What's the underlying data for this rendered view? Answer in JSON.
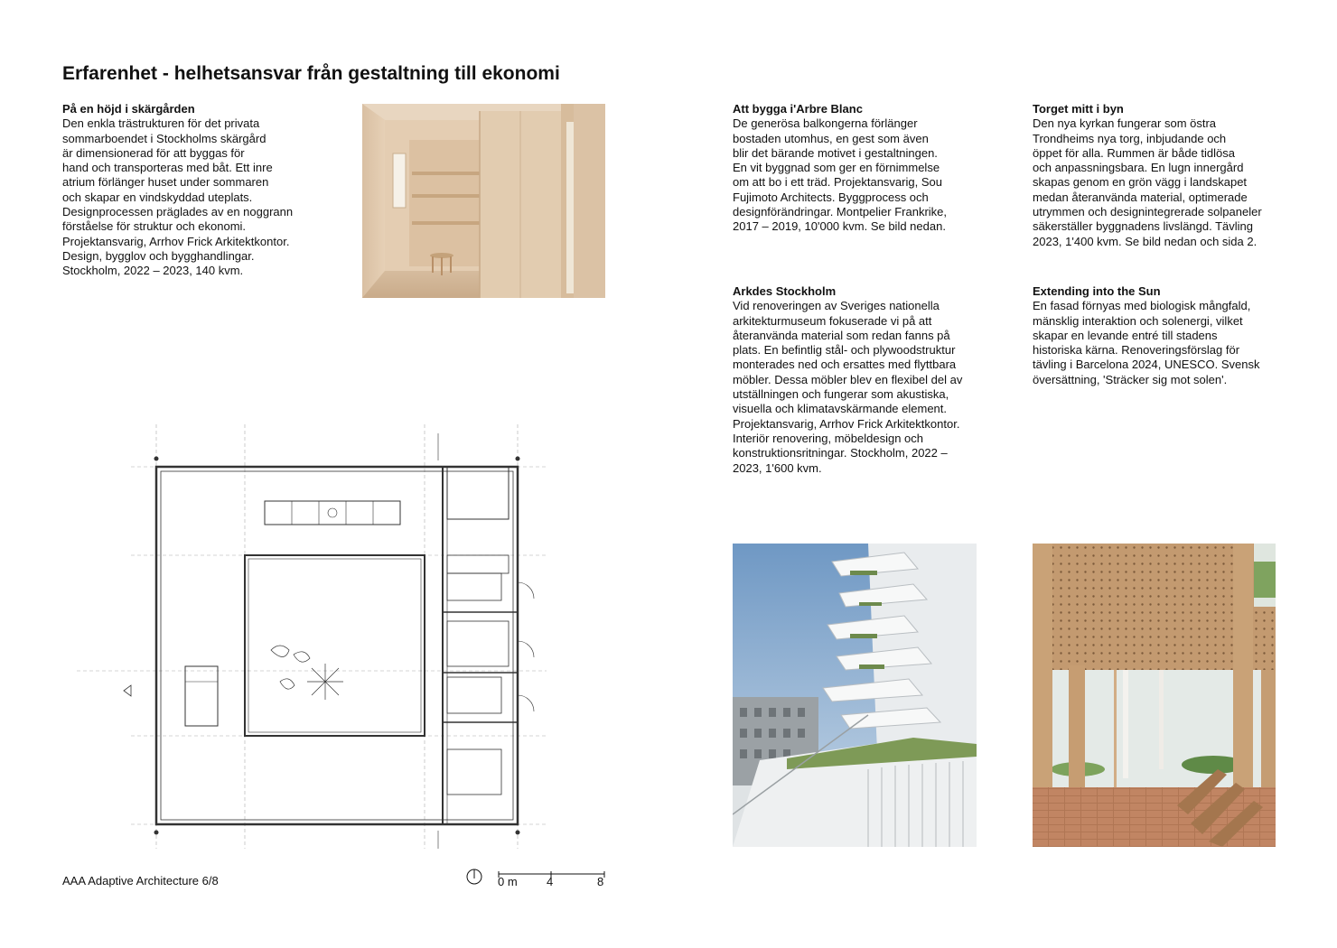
{
  "page": {
    "title": "Erfarenhet - helhetsansvar från gestaltning till ekonomi",
    "footer": "AAA Adaptive Architecture 6/8"
  },
  "projects": [
    {
      "heading": "På en höjd i skärgården",
      "body": "Den enkla trästrukturen för det privata\nsommarboendet i Stockholms skärgård\när dimensionerad för att byggas för\nhand och transporteras med båt. Ett inre\natrium förlänger huset under sommaren\noch skapar en vindskyddad uteplats.\nDesignprocessen präglades av en noggrann\nförståelse för struktur och ekonomi.\nProjektansvarig, Arrhov Frick Arkitektkontor.\nDesign, bygglov och bygghandlingar.\nStockholm, 2022 – 2023, 140 kvm."
    },
    {
      "heading": "Att bygga i'Arbre Blanc",
      "body": "De generösa balkongerna förlänger\nbostaden utomhus, en gest som även\nblir det bärande motivet i gestaltningen.\nEn vit byggnad som ger en förnimmelse\nom att bo i ett träd. Projektansvarig, Sou\nFujimoto Architects. Byggprocess och\ndesignförändringar. Montpelier Frankrike,\n2017 – 2019, 10'000 kvm. Se bild nedan."
    },
    {
      "heading": "Torget mitt i byn",
      "body": "Den nya kyrkan fungerar som östra\nTrondheims nya torg, inbjudande och\nöppet för alla. Rummen är både tidlösa\noch anpassningsbara. En lugn innergård\nskapas genom en grön vägg i landskapet\nmedan återanvända material, optimerade\nutrymmen och designintegrerade solpaneler\nsäkerställer byggnadens livslängd. Tävling\n2023, 1'400 kvm. Se bild nedan och sida 2."
    },
    {
      "heading": "Arkdes Stockholm",
      "body": "Vid renoveringen av Sveriges nationella\narkitekturmuseum fokuserade vi på att\nåteranvända material som redan fanns på\nplats. En befintlig stål- och plywoodstruktur\nmonterades ned och ersattes med flyttbara\nmöbler. Dessa möbler blev en flexibel del av\nutställningen och fungerar som akustiska,\nvisuella och klimatavskärmande element.\nProjektansvarig, Arrhov Frick Arkitektkontor.\nInteriör renovering, möbeldesign och\nkonstruktionsritningar. Stockholm, 2022 –\n2023, 1'600 kvm."
    },
    {
      "heading": "Extending into the Sun",
      "body": "En fasad förnyas med biologisk mångfald,\nmänsklig interaktion och solenergi, vilket\nskapar en levande entré till stadens\nhistoriska kärna. Renoveringsförslag för\ntävling i Barcelona 2024, UNESCO. Svensk\növersättning, 'Sträcker sig mot solen'."
    }
  ],
  "scale_bar": {
    "labels": [
      "0 m",
      "4",
      "8"
    ]
  },
  "images": {
    "interior": "wooden-interior-photo",
    "plan": "floor-plan-drawing",
    "tower": "white-tower-balconies-photo",
    "church": "timber-facade-render"
  }
}
